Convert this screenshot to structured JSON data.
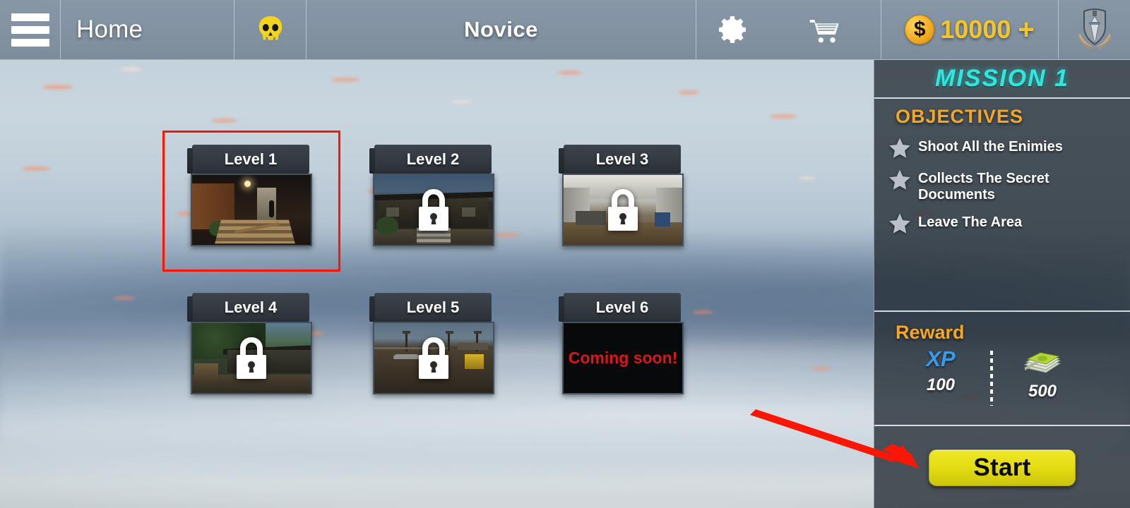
{
  "topbar": {
    "menu_icon": "hamburger-menu-icon",
    "home_label": "Home",
    "skull_icon": "skull-icon",
    "screen_title": "Novice",
    "settings_icon": "gear-icon",
    "shop_icon": "shopping-cart-icon",
    "coin_icon": "dollar-coin-icon",
    "coin_amount": "10000",
    "coin_plus": "+",
    "rank_icon": "rank-badge-icon"
  },
  "levels": [
    {
      "label": "Level 1",
      "state": "unlocked",
      "selected": true,
      "scene": "dark-interior-stairs"
    },
    {
      "label": "Level 2",
      "state": "locked",
      "selected": false,
      "scene": "building-exterior-dusk"
    },
    {
      "label": "Level 3",
      "state": "locked",
      "selected": false,
      "scene": "indoor-office-hall"
    },
    {
      "label": "Level 4",
      "state": "locked",
      "selected": false,
      "scene": "jungle-outpost"
    },
    {
      "label": "Level 5",
      "state": "locked",
      "selected": false,
      "scene": "open-airfield"
    },
    {
      "label": "Level 6",
      "state": "coming-soon",
      "selected": false,
      "coming_soon_text": "Coming\nsoon!"
    }
  ],
  "panel": {
    "mission_title": "MISSION 1",
    "objectives_title": "OBJECTIVES",
    "objectives": [
      "Shoot All the Enimies",
      "Collects The Secret Documents",
      "Leave The Area"
    ],
    "reward_title": "Reward",
    "reward_xp_label": "XP",
    "reward_xp_value": "100",
    "reward_money_icon": "money-stack-icon",
    "reward_money_value": "500",
    "start_label": "Start"
  },
  "annotation": {
    "arrow": "red-pointer-arrow",
    "points_to": "Start"
  },
  "colors": {
    "accent_cyan": "#2ee8e0",
    "accent_orange": "#f5a623",
    "accent_yellow": "#f5c528",
    "start_yellow": "#e5dc12",
    "xp_blue": "#3a9ae8",
    "coming_soon_red": "#e01515",
    "selection_red": "#ff1505",
    "panel_bg": "#262e36"
  }
}
